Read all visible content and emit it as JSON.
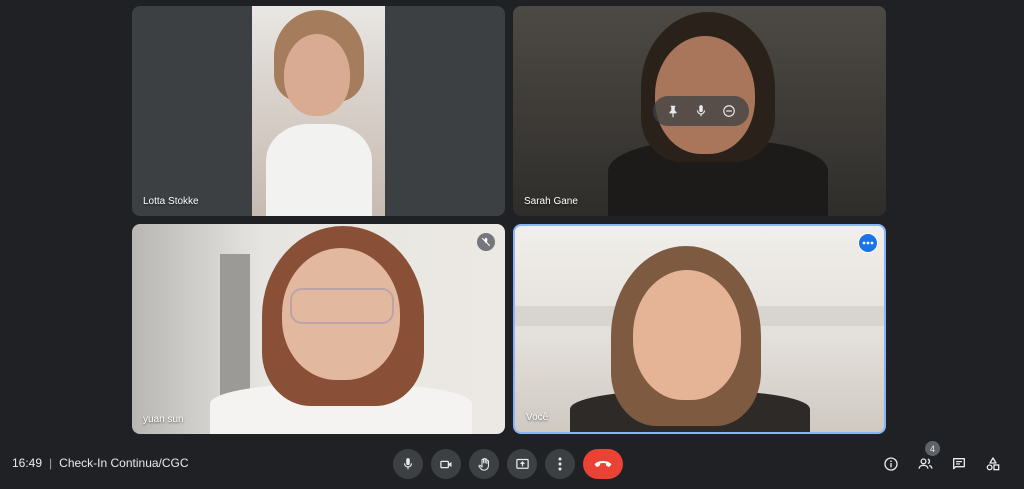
{
  "participants": [
    {
      "name": "Lotta Stokke"
    },
    {
      "name": "Sarah Gane"
    },
    {
      "name": "yuan sun",
      "muted": true
    },
    {
      "name": "Você",
      "active_speaker": true
    }
  ],
  "meeting": {
    "time": "16:49",
    "separator": "|",
    "title": "Check-In Continua/CGC"
  },
  "controls": {
    "icons": [
      "mic-icon",
      "camera-icon",
      "raise-hand-icon",
      "present-screen-icon",
      "more-options-icon",
      "end-call-icon"
    ]
  },
  "side_controls": {
    "people_count": "4",
    "icons": [
      "info-icon",
      "people-icon",
      "chat-icon",
      "activities-icon"
    ]
  },
  "colors": {
    "background": "#202124",
    "control_bg": "#3c4043",
    "end_call": "#ea4335",
    "accent": "#1a73e8",
    "active_border": "#8ab4f8"
  }
}
